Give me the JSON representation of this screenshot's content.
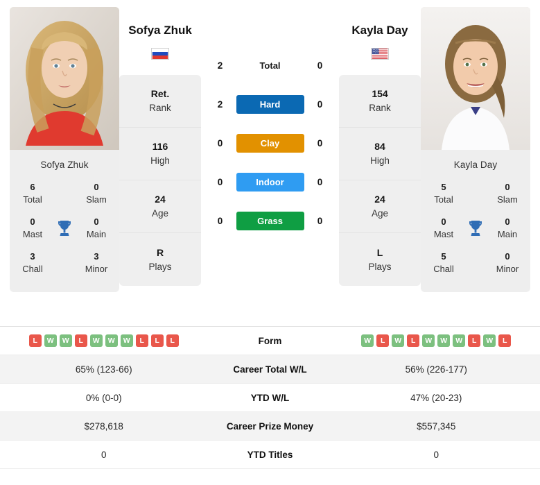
{
  "left_player": {
    "name": "Sofya Zhuk",
    "flag": "russia-flag",
    "photo_caption": "Sofya Zhuk",
    "titles": [
      {
        "value": "6",
        "label": "Total"
      },
      {
        "value": "0",
        "label": "Slam"
      },
      {
        "value": "0",
        "label": "Mast"
      },
      {
        "value": "0",
        "label": "Main"
      },
      {
        "value": "3",
        "label": "Chall"
      },
      {
        "value": "3",
        "label": "Minor"
      }
    ],
    "stats": [
      {
        "value": "Ret.",
        "label": "Rank"
      },
      {
        "value": "116",
        "label": "High"
      },
      {
        "value": "24",
        "label": "Age"
      },
      {
        "value": "R",
        "label": "Plays"
      }
    ],
    "surface_wins": {
      "total": "2",
      "hard": "2",
      "clay": "0",
      "indoor": "0",
      "grass": "0"
    },
    "form": [
      "L",
      "W",
      "W",
      "L",
      "W",
      "W",
      "W",
      "L",
      "L",
      "L"
    ],
    "career_total_wl": "65% (123-66)",
    "ytd_wl": "0% (0-0)",
    "career_prize_money": "$278,618",
    "ytd_titles": "0"
  },
  "right_player": {
    "name": "Kayla Day",
    "flag": "usa-flag",
    "photo_caption": "Kayla Day",
    "titles": [
      {
        "value": "5",
        "label": "Total"
      },
      {
        "value": "0",
        "label": "Slam"
      },
      {
        "value": "0",
        "label": "Mast"
      },
      {
        "value": "0",
        "label": "Main"
      },
      {
        "value": "5",
        "label": "Chall"
      },
      {
        "value": "0",
        "label": "Minor"
      }
    ],
    "stats": [
      {
        "value": "154",
        "label": "Rank"
      },
      {
        "value": "84",
        "label": "High"
      },
      {
        "value": "24",
        "label": "Age"
      },
      {
        "value": "L",
        "label": "Plays"
      }
    ],
    "surface_wins": {
      "total": "0",
      "hard": "0",
      "clay": "0",
      "indoor": "0",
      "grass": "0"
    },
    "form": [
      "W",
      "L",
      "W",
      "L",
      "W",
      "W",
      "W",
      "L",
      "W",
      "L"
    ],
    "career_total_wl": "56% (226-177)",
    "ytd_wl": "47% (20-23)",
    "career_prize_money": "$557,345",
    "ytd_titles": "0"
  },
  "surfaces": [
    {
      "key": "total",
      "label": "Total",
      "color": "transparent",
      "plain": true
    },
    {
      "key": "hard",
      "label": "Hard",
      "color": "#0b69b3",
      "plain": false
    },
    {
      "key": "clay",
      "label": "Clay",
      "color": "#e29100",
      "plain": false
    },
    {
      "key": "indoor",
      "label": "Indoor",
      "color": "#2f9cf2",
      "plain": false
    },
    {
      "key": "grass",
      "label": "Grass",
      "color": "#0f9e43",
      "plain": false
    }
  ],
  "table_labels": {
    "form": "Form",
    "career_total_wl": "Career Total W/L",
    "ytd_wl": "YTD W/L",
    "career_prize_money": "Career Prize Money",
    "ytd_titles": "YTD Titles"
  },
  "colors": {
    "win_badge": "#7cc07f",
    "loss_badge": "#e9574b",
    "hard": "#0b69b3",
    "clay": "#e29100",
    "indoor": "#2f9cf2",
    "grass": "#0f9e43",
    "trophy": "#2f6db5",
    "card_bg": "#eeeeee"
  },
  "icons": {
    "trophy": "trophy-icon"
  }
}
